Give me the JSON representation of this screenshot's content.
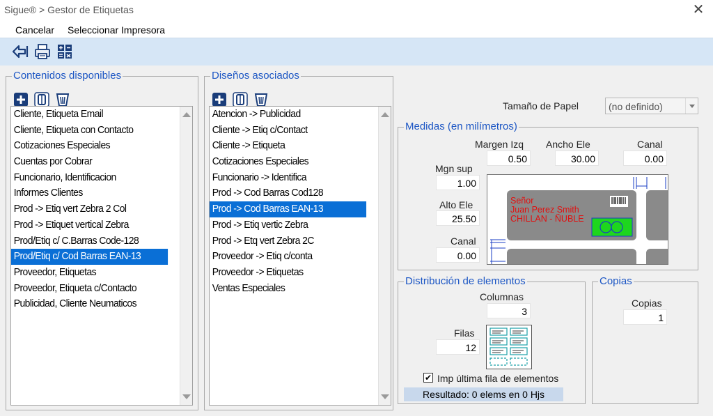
{
  "window": {
    "title": "Sigue® > Gestor de Etiquetas",
    "close_glyph": "✕"
  },
  "menu": {
    "cancel": "Cancelar",
    "select_printer": "Seleccionar Impresora"
  },
  "toolbar": {
    "icons": [
      "back-icon",
      "print-icon",
      "calculator-icon"
    ]
  },
  "contenidos": {
    "title": "Contenidos disponibles",
    "selected_index": 9,
    "items": [
      "Cliente, Etiqueta Email",
      "Cliente, Etiqueta con Contacto",
      "Cotizaciones Especiales",
      "Cuentas por Cobrar",
      "Funcionario, Identificacion",
      "Informes Clientes",
      "Prod -> Etiq vert Zebra 2 Col",
      "Prod -> Etiquet vertical Zebra",
      "Prod/Etiq c/ C.Barras Code-128",
      "Prod/Etiq c/ Cod Barras EAN-13",
      "Proveedor, Etiquetas",
      "Proveedor, Etiqueta c/Contacto",
      "Publicidad, Cliente Neumaticos"
    ]
  },
  "disenos": {
    "title": "Diseños asociados",
    "selected_index": 6,
    "items": [
      "Atencion -> Publicidad",
      "Cliente -> Etiq c/Contact",
      "Cliente -> Etiqueta",
      "Cotizaciones Especiales",
      "Funcionario -> Identifica",
      "Prod -> Cod Barras Cod128",
      "Prod -> Cod Barras EAN-13",
      "Prod -> Etiq vertic Zebra",
      "Prod -> Etq vert Zebra 2C",
      "Proveedor -> Etiq c/conta",
      "Proveedor -> Etiquetas",
      "Ventas Especiales"
    ]
  },
  "paper": {
    "label": "Tamaño de Papel",
    "value": "(no definido)"
  },
  "medidas": {
    "title": "Medidas (en milímetros)",
    "margen_izq_label": "Margen Izq",
    "margen_izq": "0.50",
    "ancho_ele_label": "Ancho Ele",
    "ancho_ele": "30.00",
    "canal_top_label": "Canal",
    "canal_top": "0.00",
    "mgn_sup_label": "Mgn sup",
    "mgn_sup": "1.00",
    "alto_ele_label": "Alto Ele",
    "alto_ele": "25.50",
    "canal_left_label": "Canal",
    "canal_left": "0.00",
    "preview_lines": [
      "Señor",
      "Juan Perez Smith",
      "CHILLAN - ÑUBLE"
    ]
  },
  "distribucion": {
    "title": "Distribución de elementos",
    "columnas_label": "Columnas",
    "columnas": "3",
    "filas_label": "Filas",
    "filas": "12",
    "imp_label": "Imp última fila de elementos",
    "imp_checked": true,
    "resultado": "Resultado: 0 elems en 0 Hjs"
  },
  "copias": {
    "title": "Copias",
    "label": "Copias",
    "value": "1"
  },
  "colors": {
    "accent": "#1c56c4",
    "selection": "#0a6fd6",
    "toolbar": "#d6e6f6"
  }
}
